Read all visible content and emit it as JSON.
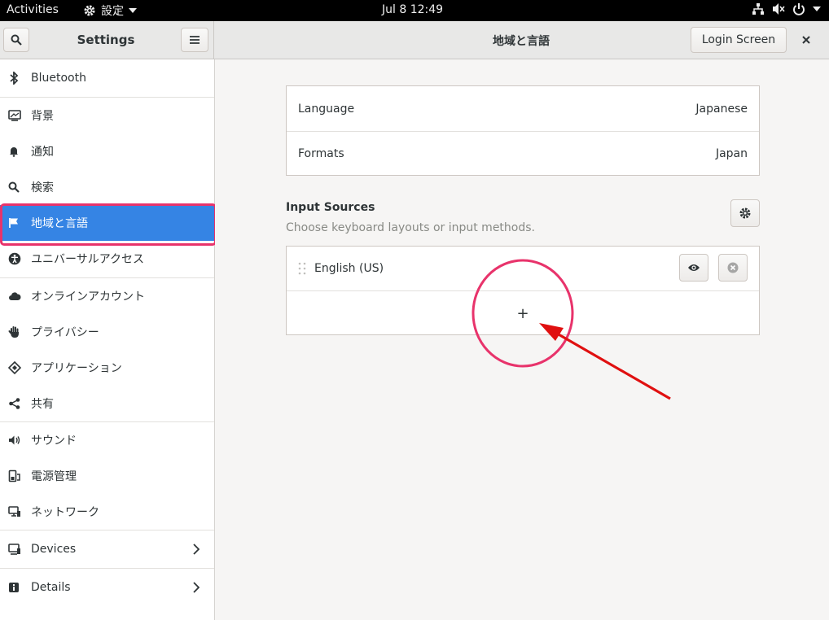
{
  "topbar": {
    "activities": "Activities",
    "app_name": "設定",
    "clock": "Jul 8  12:49"
  },
  "header": {
    "sidebar_title": "Settings",
    "main_title": "地域と言語",
    "login_screen_button": "Login Screen"
  },
  "sidebar": {
    "items": [
      {
        "label": "Bluetooth",
        "icon": "bluetooth-icon"
      },
      {
        "label": "背景",
        "icon": "background-icon"
      },
      {
        "label": "通知",
        "icon": "bell-icon"
      },
      {
        "label": "検索",
        "icon": "search-icon"
      },
      {
        "label": "地域と言語",
        "icon": "flag-icon",
        "selected": true
      },
      {
        "label": "ユニバーサルアクセス",
        "icon": "accessibility-icon"
      },
      {
        "label": "オンラインアカウント",
        "icon": "cloud-icon"
      },
      {
        "label": "プライバシー",
        "icon": "hand-icon"
      },
      {
        "label": "アプリケーション",
        "icon": "applications-icon"
      },
      {
        "label": "共有",
        "icon": "share-icon"
      },
      {
        "label": "サウンド",
        "icon": "speaker-icon"
      },
      {
        "label": "電源管理",
        "icon": "power-icon"
      },
      {
        "label": "ネットワーク",
        "icon": "network-icon"
      },
      {
        "label": "Devices",
        "icon": "devices-icon"
      },
      {
        "label": "Details",
        "icon": "info-icon"
      }
    ]
  },
  "language_frame": {
    "language_label": "Language",
    "language_value": "Japanese",
    "formats_label": "Formats",
    "formats_value": "Japan"
  },
  "input_sources": {
    "title": "Input Sources",
    "subtitle": "Choose keyboard layouts or input methods.",
    "sources": [
      {
        "name": "English (US)"
      }
    ],
    "add_label": "+"
  },
  "annotation": {
    "color": "#e8336b",
    "arrow_color": "#e01010"
  },
  "colors": {
    "accent": "#3584e4",
    "topbar": "#000000"
  }
}
